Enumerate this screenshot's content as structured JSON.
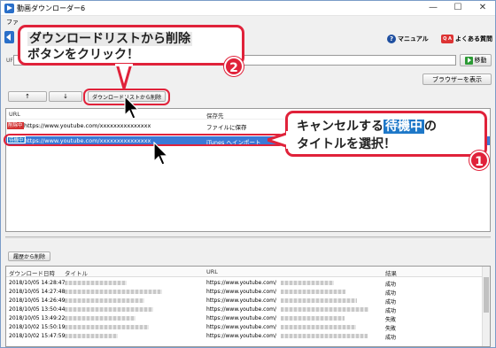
{
  "window": {
    "title": "動画ダウンローダー6",
    "controls": [
      "—",
      "☐",
      "✕"
    ]
  },
  "menu": {
    "file": "ファ"
  },
  "toolbar": {
    "manual": "マニュアル",
    "faq": "よくある質問",
    "faq_badge": "Q A",
    "help_badge": "?"
  },
  "url_bar": {
    "label": "UF",
    "value": "",
    "go_button": "移動",
    "browser_button": "ブラウザーを表示"
  },
  "queue_controls": {
    "up": "↑",
    "down": "↓",
    "delete_from_list": "ダウンロードリストから削除"
  },
  "queue": {
    "columns": [
      "URL",
      "保存先"
    ],
    "rows": [
      {
        "status": "削除中",
        "status_color": "#d33333",
        "url": "https://www.youtube.com/xxxxxxxxxxxxxxx",
        "dest": "ファイルに保存",
        "selected": false
      },
      {
        "status": "待機中",
        "status_color": "#1e78c8",
        "url": "https://www.youtube.com/xxxxxxxxxxxxxxx",
        "dest": "iTunes へインポート",
        "selected": true
      }
    ]
  },
  "history_controls": {
    "delete_history": "履歴から削除"
  },
  "history": {
    "columns": [
      "ダウンロード日時",
      "タイトル",
      "URL",
      "結果"
    ],
    "rows": [
      {
        "date": "2018/10/05 14:28:47",
        "url": "https://www.youtube.com/",
        "result": "成功"
      },
      {
        "date": "2018/10/05 14:27:48",
        "url": "https://www.youtube.com/",
        "result": "成功"
      },
      {
        "date": "2018/10/05 14:26:49",
        "url": "https://www.youtube.com/",
        "result": "成功"
      },
      {
        "date": "2018/10/05 13:50:44",
        "url": "https://www.youtube.com/",
        "result": "成功"
      },
      {
        "date": "2018/10/05 13:49:22",
        "url": "https://www.youtube.com/",
        "result": "失敗"
      },
      {
        "date": "2018/10/02 15:50:19",
        "url": "https://www.youtube.com/",
        "result": "失敗"
      },
      {
        "date": "2018/10/02 15:47:59",
        "url": "https://www.youtube.com/",
        "result": "成功"
      }
    ]
  },
  "callouts": {
    "step1_number": "1",
    "step1_line1_pre": "キャンセルする",
    "step1_line1_hl": "待機中",
    "step1_line1_post": "の",
    "step1_line2": "タイトルを選択！",
    "step2_number": "2",
    "step2_line1": "ダウンロードリストから削除",
    "step2_line2": "ボタンをクリック！"
  },
  "colors": {
    "accent_red": "#e0223a",
    "selection_blue": "#3b79d6",
    "highlight_blue": "#1e78c8"
  }
}
